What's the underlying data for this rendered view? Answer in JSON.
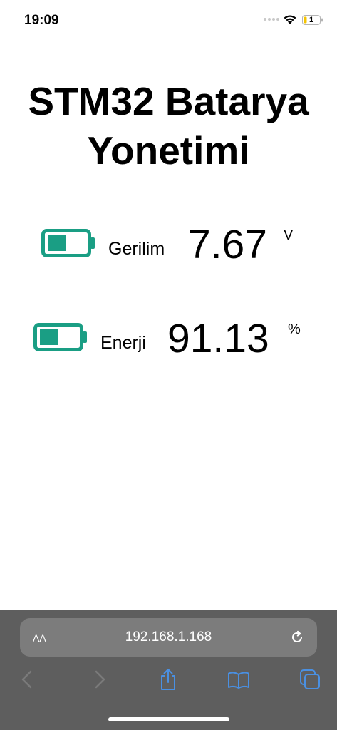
{
  "status_bar": {
    "time": "19:09",
    "battery_level": "1"
  },
  "page": {
    "title_line1": "STM32 Batarya",
    "title_line2": "Yonetimi"
  },
  "readings": {
    "voltage": {
      "label": "Gerilim",
      "value": "7.67",
      "unit": "V"
    },
    "energy": {
      "label": "Enerji",
      "value": "91.13",
      "unit": "%"
    }
  },
  "browser": {
    "text_size_button": "AA",
    "url": "192.168.1.168",
    "icons": [
      "reload-icon",
      "back-icon",
      "forward-icon",
      "share-icon",
      "bookmarks-icon",
      "tabs-icon"
    ]
  },
  "colors": {
    "battery_accent": "#1a9e84",
    "browser_bar": "#5e5e5e",
    "address_field": "#7c7c7c",
    "toolbar_active": "#4a90e2",
    "toolbar_disabled": "#7a7a7a"
  }
}
